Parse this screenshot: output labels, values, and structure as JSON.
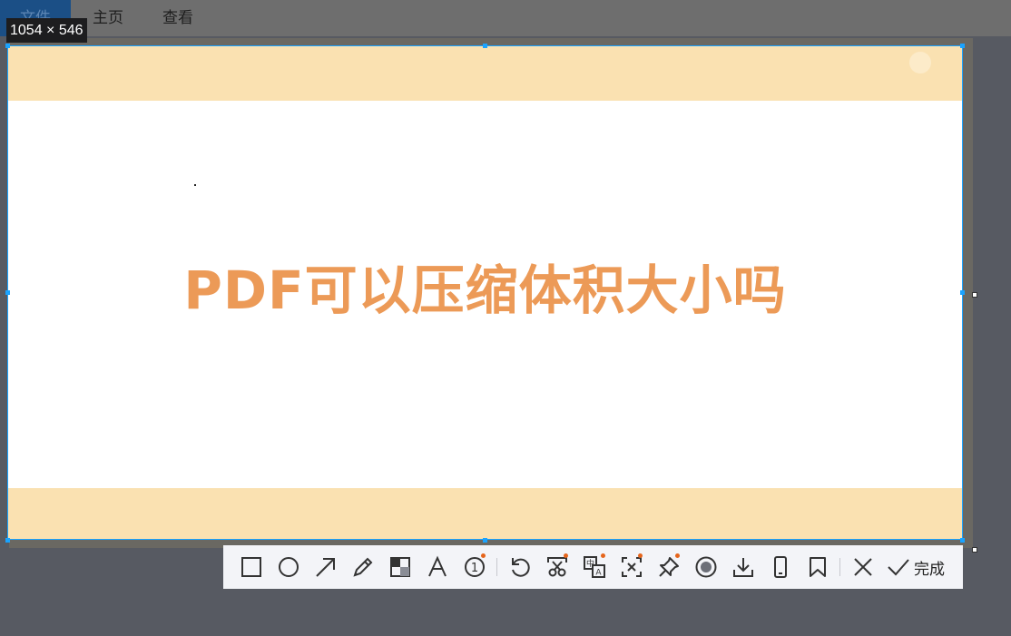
{
  "ribbon": {
    "tabs": [
      {
        "label": "文件"
      },
      {
        "label": "主页"
      },
      {
        "label": "查看"
      }
    ]
  },
  "selection": {
    "size_label": "1054 × 546"
  },
  "capture": {
    "headline": "PDF可以压缩体积大小吗",
    "accent_color": "#ec9a57",
    "band_color": "#fae1b1"
  },
  "toolbar": {
    "tools": [
      {
        "icon": "rectangle-icon"
      },
      {
        "icon": "ellipse-icon"
      },
      {
        "icon": "arrow-icon"
      },
      {
        "icon": "pencil-icon"
      },
      {
        "icon": "mosaic-icon"
      },
      {
        "icon": "text-icon"
      },
      {
        "icon": "number-marker-icon"
      },
      {
        "icon": "undo-icon"
      },
      {
        "icon": "long-screenshot-icon"
      },
      {
        "icon": "translate-icon"
      },
      {
        "icon": "ocr-icon"
      },
      {
        "icon": "pin-icon"
      },
      {
        "icon": "record-icon"
      },
      {
        "icon": "download-icon"
      },
      {
        "icon": "mobile-icon"
      },
      {
        "icon": "bookmark-icon"
      },
      {
        "icon": "close-icon"
      },
      {
        "icon": "check-icon"
      }
    ],
    "done_label": "完成"
  }
}
